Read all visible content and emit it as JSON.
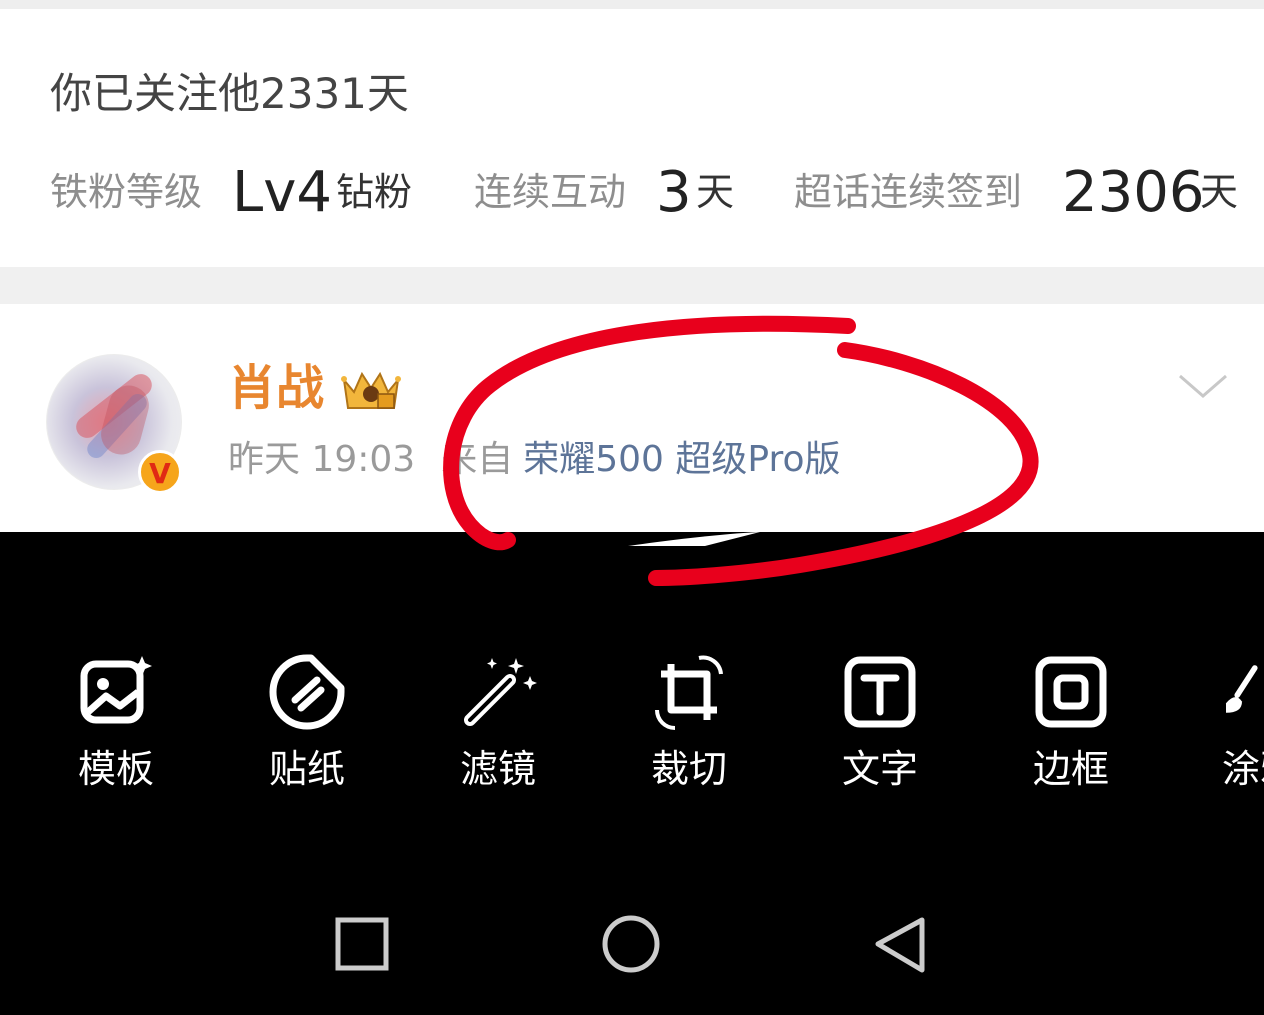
{
  "fan_card": {
    "follow_days": "你已关注他2331天",
    "iron_fan": {
      "label": "铁粉等级",
      "value": "Lv4",
      "suffix": "钻粉"
    },
    "interaction": {
      "label": "连续互动",
      "value": "3",
      "suffix": "天"
    },
    "checkin": {
      "label": "超话连续签到",
      "value": "2306",
      "suffix": "天"
    }
  },
  "post": {
    "user_name": "肖战",
    "verified_mark": "V",
    "time": "昨天 19:03",
    "from_label": "来自",
    "device": "荣耀500 超级Pro版",
    "crown_icon": "crown-badge-icon",
    "menu_icon": "chevron-down-icon"
  },
  "toolbar": {
    "items": [
      {
        "label": "模板",
        "icon": "template-icon"
      },
      {
        "label": "贴纸",
        "icon": "sticker-icon"
      },
      {
        "label": "滤镜",
        "icon": "filter-wand-icon"
      },
      {
        "label": "裁切",
        "icon": "crop-icon"
      },
      {
        "label": "文字",
        "icon": "text-icon"
      },
      {
        "label": "边框",
        "icon": "frame-icon"
      },
      {
        "label": "涂鸦",
        "icon": "brush-icon"
      }
    ]
  },
  "navbar": {
    "recents": "square-icon",
    "home": "circle-icon",
    "back": "triangle-back-icon"
  },
  "colors": {
    "username": "#e8862f",
    "device_link": "#5d7498",
    "annotation_red": "#e8001c",
    "toolbar_bg": "#000000"
  }
}
